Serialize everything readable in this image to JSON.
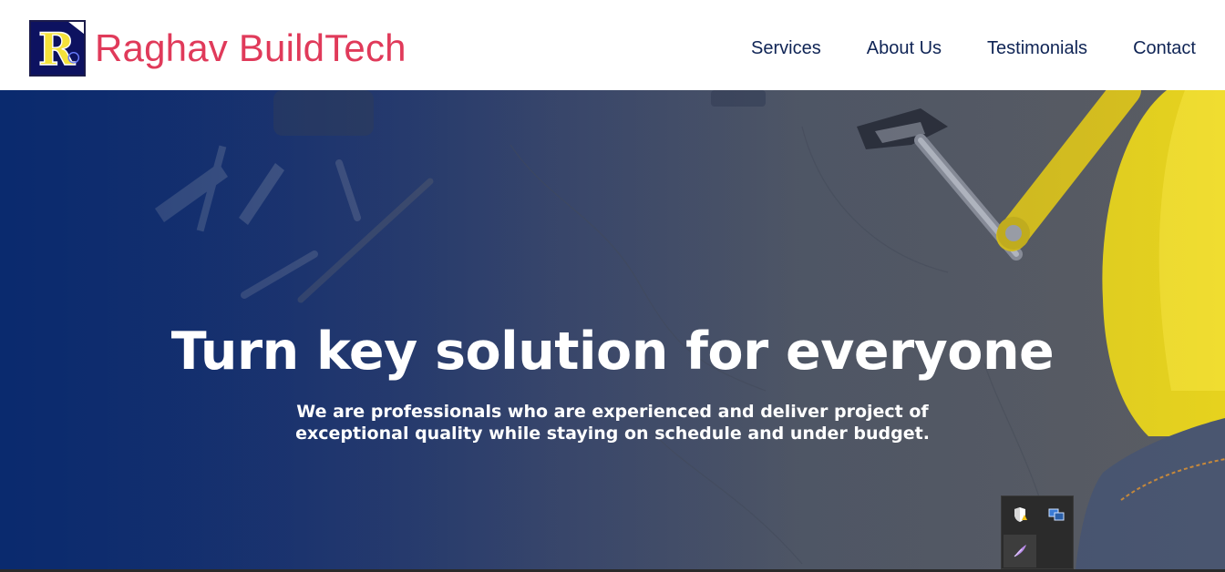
{
  "header": {
    "logo_icon": "raghav-logo-icon",
    "brand_name": "Raghav BuildTech",
    "brand_color": "#e03a5a",
    "nav_color": "#0f2455",
    "nav": [
      {
        "label": "Services"
      },
      {
        "label": "About Us"
      },
      {
        "label": "Testimonials"
      },
      {
        "label": "Contact"
      }
    ]
  },
  "hero": {
    "title": "Turn key solution for everyone",
    "subtitle": "We are professionals who are experienced and deliver project of exceptional quality while staying on schedule and under budget.",
    "background_icons": [
      "wall-plug-icon",
      "screw-icon",
      "drill-bit-icon",
      "pliers-icon",
      "wrench-icon",
      "hard-hat-icon"
    ]
  },
  "tray": {
    "icons": [
      {
        "name": "windows-security-warning-icon"
      },
      {
        "name": "network-monitor-icon"
      },
      {
        "name": "feather-app-icon"
      }
    ]
  }
}
